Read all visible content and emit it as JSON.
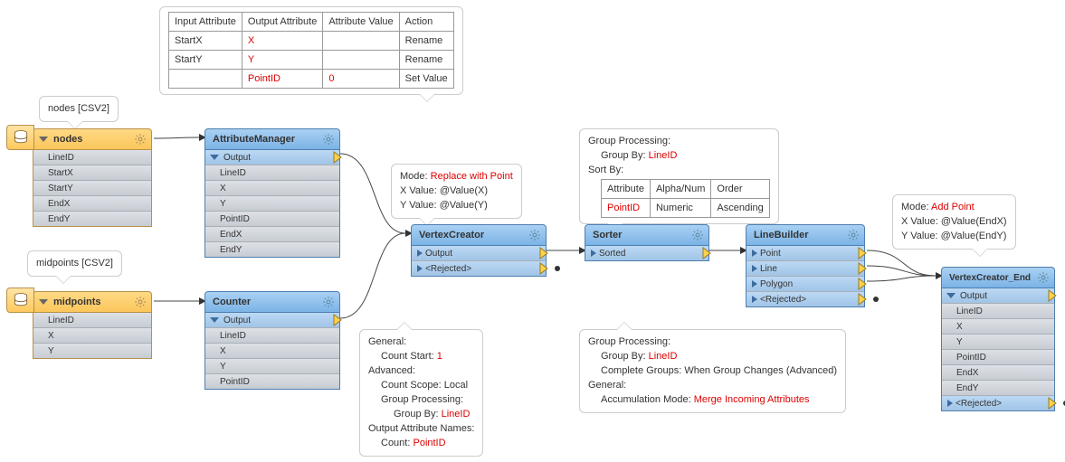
{
  "readers": {
    "nodes": {
      "balloon": "nodes [CSV2]",
      "title": "nodes",
      "attrs": [
        "LineID",
        "StartX",
        "StartY",
        "EndX",
        "EndY"
      ]
    },
    "midpoints": {
      "balloon": "midpoints [CSV2]",
      "title": "midpoints",
      "attrs": [
        "LineID",
        "X",
        "Y"
      ]
    }
  },
  "xf": {
    "attrmgr": {
      "title": "AttributeManager",
      "outPort": "Output",
      "attrs": [
        "LineID",
        "X",
        "Y",
        "PointID",
        "EndX",
        "EndY"
      ],
      "table": {
        "headers": [
          "Input Attribute",
          "Output Attribute",
          "Attribute Value",
          "Action"
        ],
        "rows": [
          {
            "in": "StartX",
            "out": "X",
            "val": "",
            "act": "Rename"
          },
          {
            "in": "StartY",
            "out": "Y",
            "val": "",
            "act": "Rename"
          },
          {
            "in": "",
            "out": "PointID",
            "val": "0",
            "act": "Set Value"
          }
        ]
      }
    },
    "counter": {
      "title": "Counter",
      "outPort": "Output",
      "attrs": [
        "LineID",
        "X",
        "Y",
        "PointID"
      ],
      "bal": {
        "l1": "General:",
        "l2": "Count Start:",
        "v2": "1",
        "l3": "Advanced:",
        "l4": "Count Scope: Local",
        "l5": "Group Processing:",
        "l6": "Group By:",
        "v6": "LineID",
        "l7": "Output Attribute Names:",
        "l8": "Count:",
        "v8": "PointID"
      }
    },
    "vertexcreator": {
      "title": "VertexCreator",
      "p_out": "Output",
      "p_rej": "<Rejected>",
      "bal": {
        "mode_k": "Mode:",
        "mode_v": "Replace with Point",
        "xv_k": "X Value:",
        "xv_v": "@Value(X)",
        "yv_k": "Y Value:",
        "yv_v": "@Value(Y)"
      }
    },
    "sorter": {
      "title": "Sorter",
      "p_out": "Sorted",
      "bal": {
        "gp": "Group Processing:",
        "gb_k": "Group By:",
        "gb_v": "LineID",
        "sb": "Sort By:",
        "th": [
          "Attribute",
          "Alpha/Num",
          "Order"
        ],
        "row": {
          "attr": "PointID",
          "an": "Numeric",
          "ord": "Ascending"
        }
      }
    },
    "linebuilder": {
      "title": "LineBuilder",
      "ports": [
        "Point",
        "Line",
        "Polygon",
        "<Rejected>"
      ],
      "bal": {
        "gp": "Group Processing:",
        "gb_k": "Group By:",
        "gb_v": "LineID",
        "cg": "Complete Groups: When Group Changes (Advanced)",
        "gen": "General:",
        "am_k": "Accumulation Mode:",
        "am_v": "Merge Incoming Attributes"
      }
    },
    "vcend": {
      "title": "VertexCreator_End",
      "outPort": "Output",
      "p_rej": "<Rejected>",
      "attrs": [
        "LineID",
        "X",
        "Y",
        "PointID",
        "EndX",
        "EndY"
      ],
      "bal": {
        "mode_k": "Mode:",
        "mode_v": "Add Point",
        "xv_k": "X Value:",
        "xv_v": "@Value(EndX)",
        "yv_k": "Y Value:",
        "yv_v": "@Value(EndY)"
      }
    }
  },
  "chart_data": {
    "type": "flow-diagram",
    "readers": [
      {
        "name": "nodes",
        "format": "CSV2",
        "attrs": [
          "LineID",
          "StartX",
          "StartY",
          "EndX",
          "EndY"
        ]
      },
      {
        "name": "midpoints",
        "format": "CSV2",
        "attrs": [
          "LineID",
          "X",
          "Y"
        ]
      }
    ],
    "transformers": [
      {
        "name": "AttributeManager",
        "params": {
          "rows": [
            [
              "StartX",
              "X",
              "",
              "Rename"
            ],
            [
              "StartY",
              "Y",
              "",
              "Rename"
            ],
            [
              "",
              "PointID",
              "0",
              "Set Value"
            ]
          ]
        },
        "output_attrs": [
          "LineID",
          "X",
          "Y",
          "PointID",
          "EndX",
          "EndY"
        ]
      },
      {
        "name": "Counter",
        "params": {
          "Count Start": 1,
          "Count Scope": "Local",
          "Group By": "LineID",
          "Count": "PointID"
        },
        "output_attrs": [
          "LineID",
          "X",
          "Y",
          "PointID"
        ]
      },
      {
        "name": "VertexCreator",
        "params": {
          "Mode": "Replace with Point",
          "X Value": "@Value(X)",
          "Y Value": "@Value(Y)"
        },
        "output_ports": [
          "Output",
          "<Rejected>"
        ]
      },
      {
        "name": "Sorter",
        "params": {
          "Group By": "LineID",
          "Sort": [
            {
              "Attribute": "PointID",
              "Alpha/Num": "Numeric",
              "Order": "Ascending"
            }
          ]
        },
        "output_ports": [
          "Sorted"
        ]
      },
      {
        "name": "LineBuilder",
        "params": {
          "Group By": "LineID",
          "Complete Groups": "When Group Changes (Advanced)",
          "Accumulation Mode": "Merge Incoming Attributes"
        },
        "output_ports": [
          "Point",
          "Line",
          "Polygon",
          "<Rejected>"
        ]
      },
      {
        "name": "VertexCreator_End",
        "params": {
          "Mode": "Add Point",
          "X Value": "@Value(EndX)",
          "Y Value": "@Value(EndY)"
        },
        "output_attrs": [
          "LineID",
          "X",
          "Y",
          "PointID",
          "EndX",
          "EndY"
        ],
        "output_ports": [
          "Output",
          "<Rejected>"
        ]
      }
    ],
    "edges": [
      [
        "nodes",
        "AttributeManager"
      ],
      [
        "midpoints",
        "Counter"
      ],
      [
        "AttributeManager.Output",
        "VertexCreator"
      ],
      [
        "Counter.Output",
        "VertexCreator"
      ],
      [
        "VertexCreator.Output",
        "Sorter"
      ],
      [
        "Sorter.Sorted",
        "LineBuilder"
      ],
      [
        "LineBuilder.Line",
        "VertexCreator_End"
      ],
      [
        "LineBuilder.Point",
        "VertexCreator_End"
      ],
      [
        "LineBuilder.Polygon",
        "VertexCreator_End"
      ]
    ]
  }
}
